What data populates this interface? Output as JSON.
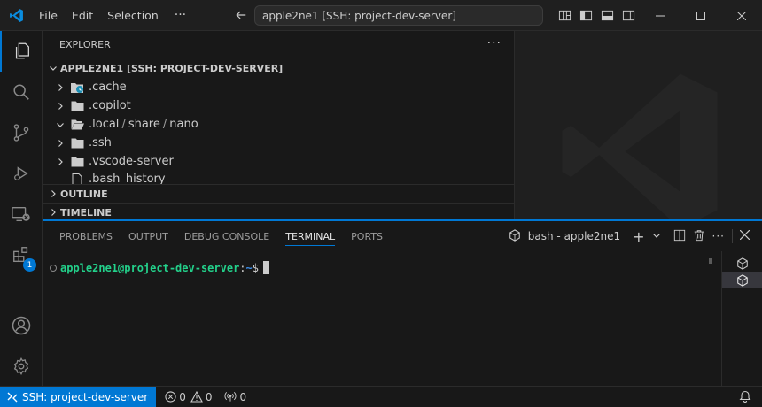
{
  "menu": {
    "file": "File",
    "edit": "Edit",
    "selection": "Selection",
    "more": "···"
  },
  "command_center": {
    "text": "apple2ne1 [SSH: project-dev-server]"
  },
  "explorer": {
    "title": "EXPLORER",
    "more": "···",
    "root": "APPLE2NE1 [SSH: PROJECT-DEV-SERVER]",
    "items": [
      {
        "label": ".cache",
        "kind": "folder-special",
        "expanded": false
      },
      {
        "label": ".copilot",
        "kind": "folder",
        "expanded": false
      },
      {
        "label_parts": [
          ".local",
          "share",
          "nano"
        ],
        "kind": "folder",
        "expanded": true
      },
      {
        "label": ".ssh",
        "kind": "folder",
        "expanded": false
      },
      {
        "label": ".vscode-server",
        "kind": "folder",
        "expanded": false
      },
      {
        "label": ".bash_history",
        "kind": "file"
      }
    ],
    "outline": "OUTLINE",
    "timeline": "TIMELINE"
  },
  "panel": {
    "tabs": [
      {
        "label": "PROBLEMS",
        "active": false
      },
      {
        "label": "OUTPUT",
        "active": false
      },
      {
        "label": "DEBUG CONSOLE",
        "active": false
      },
      {
        "label": "TERMINAL",
        "active": true
      },
      {
        "label": "PORTS",
        "active": false
      }
    ],
    "terminal_name": "bash - apple2ne1",
    "prompt": {
      "user_host": "apple2ne1@project-dev-server",
      "colon": ":",
      "path": "~",
      "symbol": "$"
    }
  },
  "activity": {
    "extensions_badge": "1"
  },
  "status": {
    "remote": "SSH: project-dev-server",
    "errors": "0",
    "warnings": "0",
    "ports": "0"
  },
  "colors": {
    "accent": "#0078d4",
    "background": "#1f1f1f",
    "sidebar": "#181818",
    "prompt_user": "#23d18b",
    "prompt_path": "#3b8eea"
  }
}
